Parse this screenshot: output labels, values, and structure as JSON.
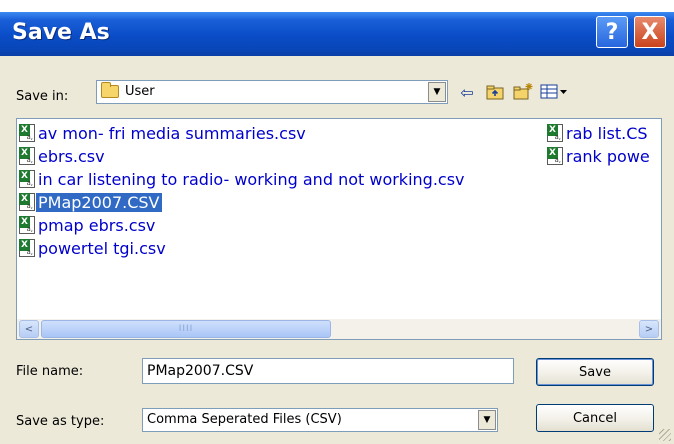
{
  "window": {
    "title": "Save As",
    "help_label": "?",
    "close_label": "X"
  },
  "toolbar": {
    "save_in_label": "Save in:",
    "save_in_value": "User",
    "icons": [
      "back-arrow-icon",
      "up-folder-icon",
      "new-folder-icon",
      "view-menu-icon"
    ],
    "back_glyph": "⇦",
    "up_glyph": "⮬",
    "new_folder_glyph": "✳",
    "view_glyph": "▦▾"
  },
  "files": [
    {
      "name": "av mon- fri media summaries.csv",
      "selected": false
    },
    {
      "name": "ebrs.csv",
      "selected": false
    },
    {
      "name": "in car listening to radio- working and not working.csv",
      "selected": false
    },
    {
      "name": "PMap2007.CSV",
      "selected": true
    },
    {
      "name": "pmap ebrs.csv",
      "selected": false
    },
    {
      "name": "powertel tgi.csv",
      "selected": false
    },
    {
      "name": "rab list.CS",
      "selected": false
    },
    {
      "name": "rank powe",
      "selected": false
    }
  ],
  "scrollbar": {
    "left_glyph": "<",
    "right_glyph": ">",
    "thumb_glyph": "IIII"
  },
  "form": {
    "file_name_label": "File name:",
    "file_name_value": "PMap2007.CSV",
    "save_as_type_label": "Save as type:",
    "save_as_type_value": "Comma Seperated Files (CSV)",
    "save_button": "Save",
    "cancel_button": "Cancel"
  },
  "colors": {
    "titlebar": "#0a4cc7",
    "selection": "#316ac5",
    "file_text": "#0000cc",
    "dialog_bg": "#ece9d8"
  }
}
